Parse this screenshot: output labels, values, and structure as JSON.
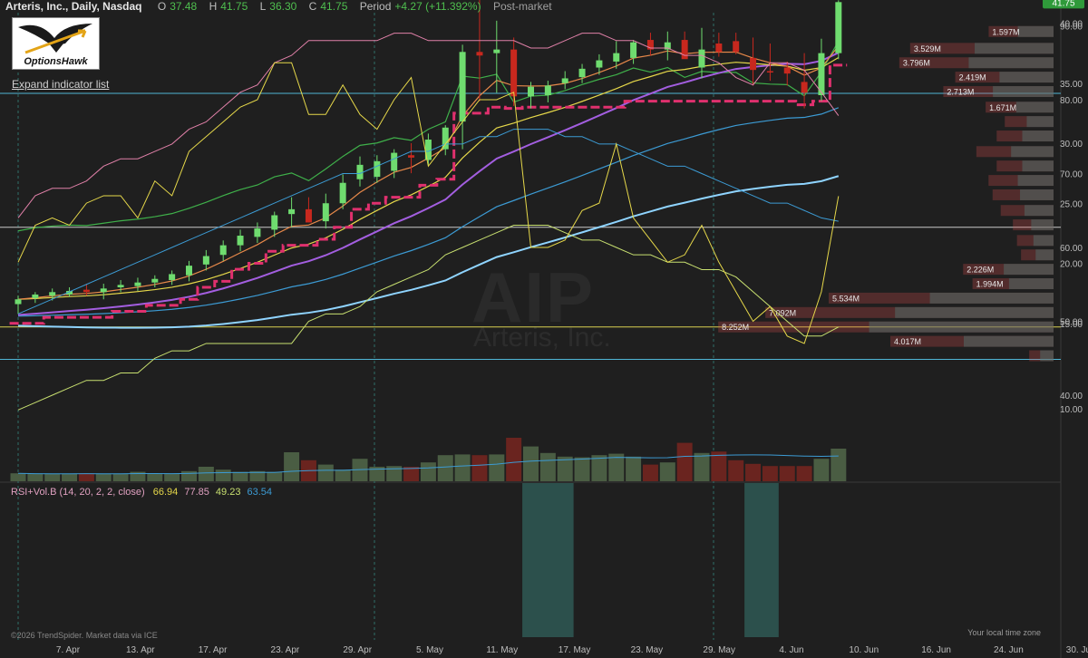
{
  "header": {
    "title": "Arteris, Inc., Daily, Nasdaq",
    "open_label": "O",
    "open": "37.48",
    "high_label": "H",
    "high": "41.75",
    "low_label": "L",
    "low": "36.30",
    "close_label": "C",
    "close": "41.75",
    "period_label": "Period",
    "period": "+4.27 (+11.392%)",
    "session": "Post-market"
  },
  "logo": {
    "text": "OptionsHawk"
  },
  "expand_link": "Expand indicator list",
  "watermark": {
    "symbol": "AIP",
    "name": "Arteris, Inc."
  },
  "rsi": {
    "label": "RSI+Vol.B (14, 20, 2, 2, close)",
    "v1": "66.94",
    "v2": "77.85",
    "v3": "49.23",
    "v4": "63.54"
  },
  "footer": "©2026 TrendSpider. Market data via ICE",
  "local_time": "Your local time zone",
  "colors": {
    "bg": "#1f1f1f",
    "up": "#6fdc6f",
    "down": "#c8281e",
    "vol_up": "#4a5d43",
    "vol_down": "#6a241f",
    "ema_orange": "#e8894a",
    "ema_yellow": "#e6d84a",
    "purple": "#a35ee0",
    "blue": "#3c9bd4",
    "lightblue": "#8fd4ff",
    "green": "#3fb04a",
    "pink": "#e0306e",
    "hline_cyan": "#4fb6d6",
    "hline_white": "#c8c8c8",
    "hline_yellow": "#d8d050"
  },
  "chart_data": [
    {
      "type": "candlestick",
      "x": [
        "Apr 6",
        "Apr 7",
        "Apr 8",
        "Apr 9",
        "Apr 10",
        "Apr 13",
        "Apr 14",
        "Apr 15",
        "Apr 16",
        "Apr 17",
        "Apr 20",
        "Apr 21",
        "Apr 22",
        "Apr 23",
        "Apr 24",
        "Apr 27",
        "Apr 28",
        "Apr 29",
        "Apr 30",
        "May 1",
        "May 4",
        "May 5",
        "May 6",
        "May 7",
        "May 8",
        "May 11",
        "May 12",
        "May 13",
        "May 14",
        "May 15",
        "May 18",
        "May 19",
        "May 20",
        "May 21",
        "May 22",
        "May 26",
        "May 27",
        "May 28",
        "May 29",
        "Jun 1",
        "Jun 2",
        "Jun 3",
        "Jun 4",
        "Jun 5",
        "Jun 8",
        "Jun 9",
        "Jun 10",
        "Jun 11",
        "Jun 12"
      ],
      "open": [
        16.6,
        17.1,
        17.3,
        17.4,
        17.8,
        17.6,
        18.0,
        18.1,
        18.4,
        18.6,
        19.0,
        19.9,
        20.7,
        21.5,
        22.2,
        22.8,
        24.1,
        24.5,
        23.5,
        25.0,
        27.0,
        27.2,
        27.7,
        29.0,
        28.6,
        29.5,
        31.8,
        37.6,
        37.5,
        37.8,
        33.9,
        34.0,
        35.0,
        35.5,
        36.3,
        36.8,
        37.1,
        38.6,
        37.8,
        38.6,
        36.3,
        38.3,
        38.5,
        37.1,
        36.0,
        36.3,
        35.1,
        34.0,
        37.5
      ],
      "high": [
        17.3,
        17.6,
        17.9,
        18.0,
        18.3,
        18.3,
        18.6,
        18.8,
        19.0,
        19.4,
        20.2,
        21.1,
        21.9,
        22.8,
        23.4,
        24.3,
        25.5,
        25.5,
        25.8,
        27.4,
        28.9,
        29.0,
        29.5,
        30.0,
        30.8,
        31.5,
        38.2,
        42.0,
        40.2,
        38.8,
        35.1,
        35.2,
        36.0,
        36.6,
        37.4,
        38.5,
        38.6,
        39.2,
        39.3,
        39.3,
        39.6,
        39.2,
        39.2,
        38.8,
        38.3,
        36.8,
        37.5,
        38.7,
        41.9
      ],
      "low": [
        15.8,
        16.7,
        16.9,
        17.2,
        17.3,
        17.0,
        17.6,
        17.7,
        18.0,
        18.2,
        18.5,
        19.4,
        20.2,
        21.0,
        21.7,
        22.2,
        23.0,
        23.4,
        22.9,
        24.5,
        26.4,
        26.7,
        27.1,
        27.5,
        28.2,
        29.0,
        29.5,
        33.5,
        34.2,
        33.1,
        32.9,
        33.4,
        34.5,
        35.0,
        35.7,
        36.2,
        36.6,
        37.3,
        36.9,
        37.4,
        35.4,
        37.2,
        37.4,
        34.8,
        35.2,
        34.8,
        32.9,
        33.5,
        37.0
      ],
      "close": [
        17.0,
        17.4,
        17.6,
        17.7,
        17.6,
        17.9,
        18.2,
        18.4,
        18.7,
        19.1,
        19.8,
        20.6,
        21.5,
        22.3,
        22.9,
        24.0,
        24.5,
        23.4,
        25.0,
        26.7,
        28.2,
        28.5,
        29.2,
        28.8,
        30.3,
        31.3,
        37.6,
        37.3,
        37.8,
        33.9,
        34.7,
        34.8,
        35.4,
        36.2,
        36.9,
        37.5,
        38.4,
        37.8,
        38.4,
        37.0,
        37.8,
        37.6,
        37.6,
        36.1,
        35.9,
        35.8,
        34.2,
        37.5,
        41.75
      ]
    },
    {
      "type": "bar",
      "name": "Volume",
      "values": [
        1.1,
        1.0,
        1.0,
        1.0,
        1.1,
        1.0,
        1.0,
        1.3,
        1.0,
        1.0,
        1.4,
        2.0,
        1.6,
        1.3,
        1.4,
        1.3,
        4.0,
        2.9,
        2.3,
        1.6,
        3.1,
        2.0,
        2.1,
        2.0,
        2.6,
        3.6,
        3.7,
        3.6,
        3.7,
        6.0,
        4.8,
        3.9,
        3.4,
        3.3,
        3.6,
        3.8,
        3.4,
        2.3,
        2.6,
        5.3,
        3.9,
        4.1,
        2.9,
        2.4,
        2.1,
        2.1,
        2.1,
        3.1,
        4.5
      ],
      "ylabels": [
        "10.00"
      ]
    },
    {
      "type": "line",
      "name": "RSI",
      "values": [
        58,
        63,
        64,
        63,
        66,
        67,
        67,
        64,
        69,
        67,
        73,
        75,
        77,
        79,
        80,
        85,
        85,
        78,
        78,
        82,
        78,
        76,
        80,
        83,
        71,
        74,
        77,
        80,
        80,
        81,
        60,
        60,
        61,
        65,
        66,
        74,
        64,
        61,
        58,
        59,
        63,
        58,
        54,
        50,
        52,
        48,
        47,
        54,
        66.94
      ],
      "series": [
        {
          "values": [
            64,
            67,
            68,
            68,
            69,
            71,
            72,
            72,
            73,
            74,
            76,
            77,
            79,
            81,
            82,
            85,
            86,
            88,
            88,
            88,
            88,
            88,
            89,
            89,
            88,
            88,
            88,
            88,
            88,
            88,
            87,
            87,
            88,
            89,
            89,
            88,
            88,
            87,
            87,
            86,
            86,
            85,
            83,
            82,
            85,
            85,
            84,
            81,
            77.85
          ]
        },
        {
          "values": [
            38,
            39,
            40,
            41,
            42,
            42,
            43,
            43,
            45,
            46,
            46,
            47,
            47,
            47,
            47,
            47,
            47,
            50,
            51,
            51,
            52,
            54,
            55,
            56,
            57,
            59,
            60,
            61,
            62,
            63,
            63,
            63,
            62,
            61,
            61,
            60,
            59,
            59,
            58,
            58,
            57,
            57,
            56,
            54,
            52,
            50,
            48,
            48,
            49.23
          ]
        },
        {
          "values": [
            51,
            52,
            53,
            54,
            55,
            56,
            57,
            58,
            59,
            60,
            61,
            62,
            63,
            64,
            65,
            66,
            67,
            68,
            69,
            70,
            70,
            71,
            72,
            73,
            73,
            74,
            74,
            75,
            75,
            76,
            76,
            76,
            75,
            75,
            74,
            74,
            73,
            72,
            71,
            71,
            70,
            69,
            68,
            67,
            66,
            66,
            65,
            64,
            63.54
          ]
        }
      ],
      "yticks": [
        "90.00",
        "80.00",
        "70.00",
        "60.00",
        "50.00",
        "40.00"
      ],
      "highlight_ranges": [
        [
          "May 18",
          "May 20"
        ],
        [
          "Jun 5",
          "Jun 8"
        ]
      ]
    },
    {
      "type": "volume_profile",
      "bins": [
        {
          "price": 39.3,
          "total": 1.597,
          "label": "1.597M"
        },
        {
          "price": 37.9,
          "total": 3.529,
          "label": "3.529M"
        },
        {
          "price": 36.7,
          "total": 3.796,
          "label": "3.796M"
        },
        {
          "price": 35.5,
          "total": 2.419,
          "label": "2.419M"
        },
        {
          "price": 34.3,
          "total": 2.713,
          "label": "2.713M"
        },
        {
          "price": 33.0,
          "total": 1.671,
          "label": "1.671M"
        },
        {
          "price": 31.8,
          "total": 1.2,
          "label": ""
        },
        {
          "price": 30.6,
          "total": 1.4,
          "label": ""
        },
        {
          "price": 29.3,
          "total": 1.9,
          "label": ""
        },
        {
          "price": 28.1,
          "total": 1.4,
          "label": ""
        },
        {
          "price": 26.9,
          "total": 1.6,
          "label": ""
        },
        {
          "price": 25.7,
          "total": 1.5,
          "label": ""
        },
        {
          "price": 24.4,
          "total": 1.3,
          "label": ""
        },
        {
          "price": 23.2,
          "total": 1.0,
          "label": ""
        },
        {
          "price": 21.9,
          "total": 0.9,
          "label": ""
        },
        {
          "price": 20.7,
          "total": 0.8,
          "label": ""
        },
        {
          "price": 19.5,
          "total": 2.226,
          "label": "2.226M"
        },
        {
          "price": 18.3,
          "total": 1.994,
          "label": "1.994M"
        },
        {
          "price": 17.1,
          "total": 5.534,
          "label": "5.534M"
        },
        {
          "price": 15.9,
          "total": 7.092,
          "label": "7.092M"
        },
        {
          "price": 14.7,
          "total": 8.252,
          "label": "8.252M"
        },
        {
          "price": 13.5,
          "total": 4.017,
          "label": "4.017M"
        },
        {
          "price": 12.3,
          "total": 0.6,
          "label": ""
        }
      ]
    }
  ],
  "price_axis": {
    "ticks": [
      "40.00",
      "35.00",
      "30.00",
      "25.00",
      "20.00",
      "15.00"
    ],
    "last_price": "41.75"
  },
  "date_axis": [
    "7. Apr",
    "13. Apr",
    "17. Apr",
    "23. Apr",
    "29. Apr",
    "5. May",
    "11. May",
    "17. May",
    "23. May",
    "29. May",
    "4. Jun",
    "10. Jun",
    "16. Jun",
    "24. Jun",
    "30. Jun"
  ],
  "horizontal_lines": [
    {
      "price": 34.15,
      "color": "#4fb6d6"
    },
    {
      "price": 23.0,
      "color": "#c8c8c8"
    },
    {
      "price": 14.7,
      "color": "#d8d050"
    },
    {
      "price": 12.0,
      "color": "#4fb6d6"
    }
  ]
}
